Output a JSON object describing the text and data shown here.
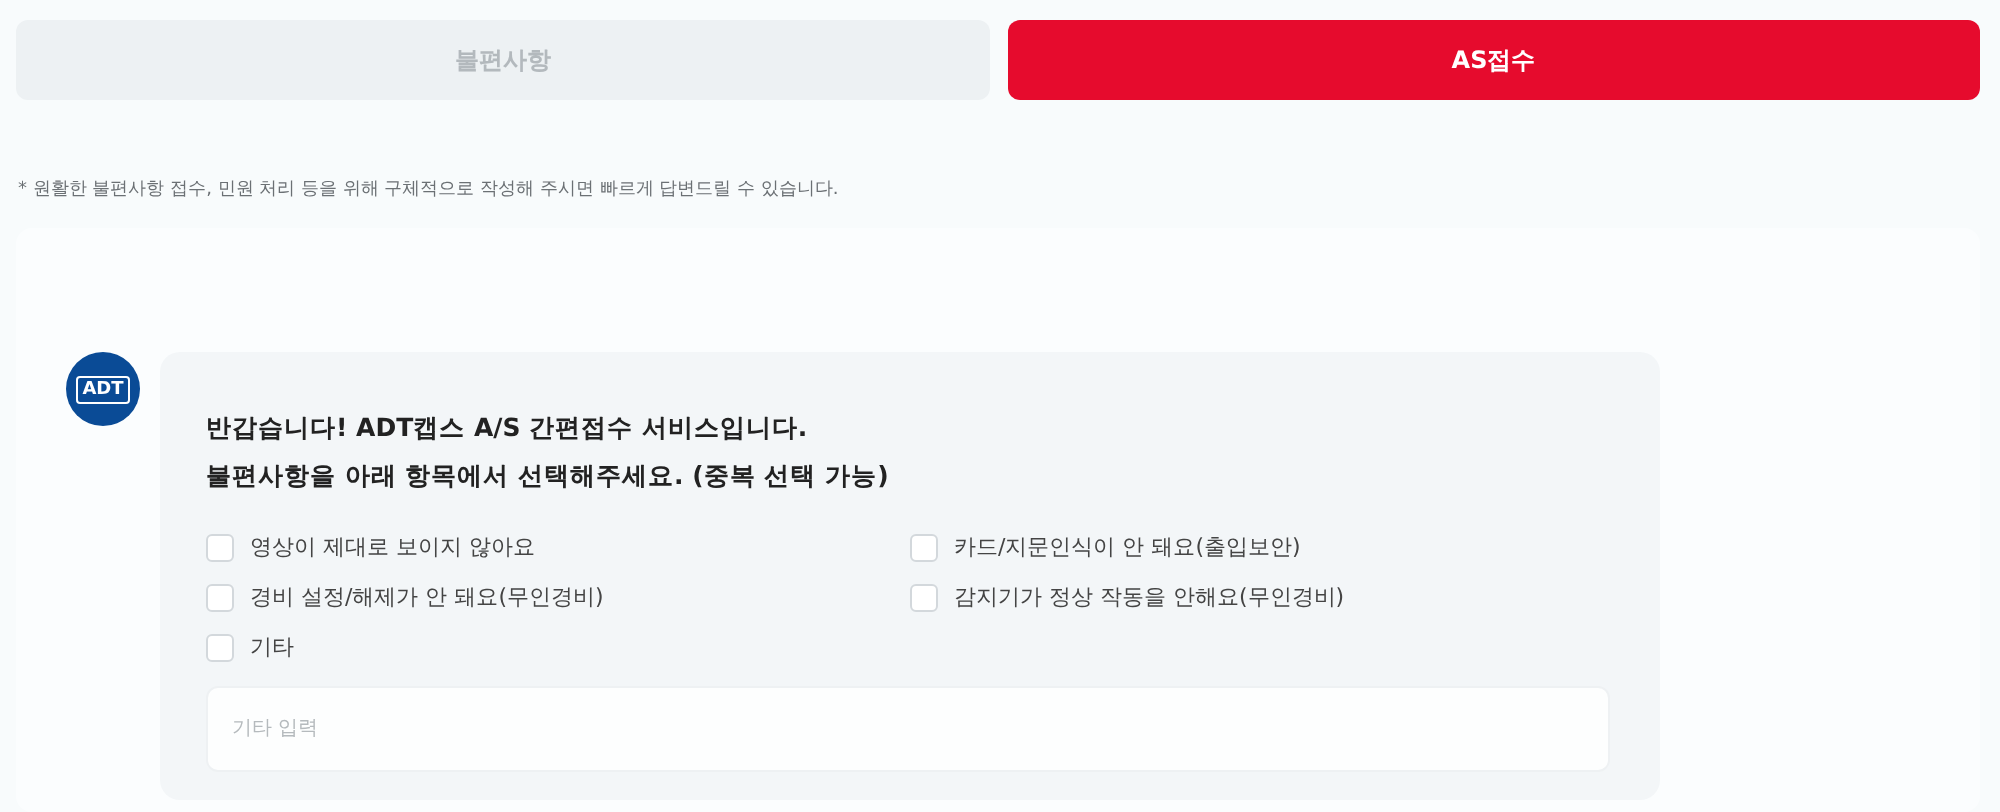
{
  "tabs": [
    {
      "label": "불편사항",
      "selected": false
    },
    {
      "label": "AS접수",
      "selected": true
    }
  ],
  "notice": "* 원활한 불편사항 접수, 민원 처리 등을 위해 구체적으로 작성해 주시면 빠르게 답변드릴 수 있습니다.",
  "chat": {
    "avatar_logo": "ADT",
    "greeting": "반갑습니다! ADT캡스 A/S 간편접수 서비스입니다.",
    "prompt": "불편사항을 아래 항목에서 선택해주세요. (중복 선택 가능)",
    "options": [
      {
        "label": "영상이 제대로 보이지 않아요",
        "checked": false
      },
      {
        "label": "카드/지문인식이 안 돼요(출입보안)",
        "checked": false
      },
      {
        "label": "경비 설정/해제가 안 돼요(무인경비)",
        "checked": false
      },
      {
        "label": "감지기가 정상 작동을 안해요(무인경비)",
        "checked": false
      },
      {
        "label": "기타",
        "checked": false
      }
    ],
    "other_input": {
      "placeholder": "기타 입력"
    }
  }
}
